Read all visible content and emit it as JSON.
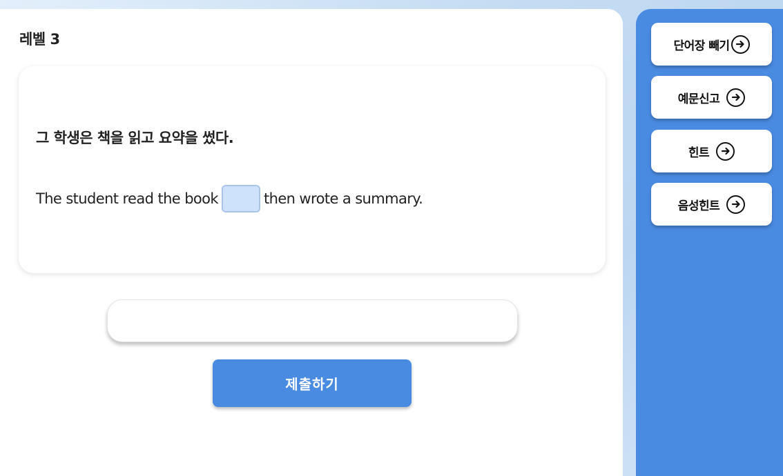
{
  "level": {
    "title": "레벨 3"
  },
  "question": {
    "korean": "그 학생은 책을 읽고 요약을 썼다.",
    "english_before": "The student read the book",
    "english_after": "then wrote a summary."
  },
  "answer": {
    "value": "",
    "placeholder": ""
  },
  "submit": {
    "label": "제출하기"
  },
  "sidebar": {
    "items": [
      {
        "label": "단어장 빼기",
        "icon": "arrow-right-circle-icon"
      },
      {
        "label": "예문신고",
        "icon": "arrow-right-circle-icon"
      },
      {
        "label": "힌트",
        "icon": "arrow-right-circle-icon"
      },
      {
        "label": "음성힌트",
        "icon": "arrow-right-circle-icon"
      }
    ]
  },
  "colors": {
    "accent": "#4a8be2",
    "blank": "#cfe2fb"
  }
}
